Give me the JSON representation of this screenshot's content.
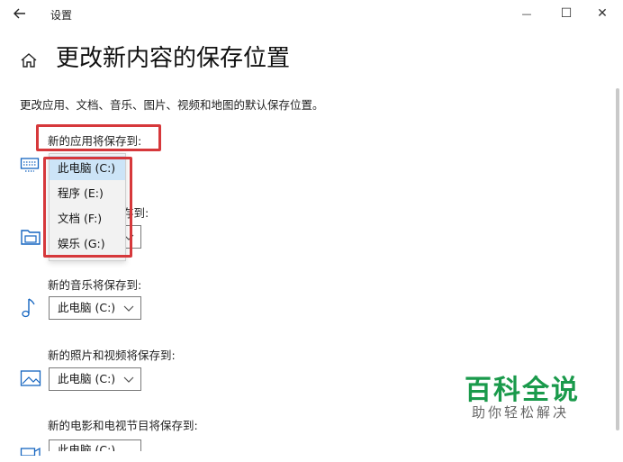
{
  "window": {
    "title": "设置",
    "back_icon": "arrow-left-icon",
    "minimize_glyph": "—",
    "maximize_glyph": "☐",
    "close_glyph": "✕"
  },
  "header": {
    "home_icon": "home-icon",
    "title": "更改新内容的保存位置"
  },
  "description": "更改应用、文档、音乐、图片、视频和地图的默认保存位置。",
  "sections": [
    {
      "label": "新的应用将保存到:",
      "icon": "monitor-icon",
      "value": "此电脑 (C:)"
    },
    {
      "label": "新的文档将保存到:",
      "icon": "folder-icon",
      "value": "此电脑 (C:)"
    },
    {
      "label": "新的音乐将保存到:",
      "icon": "music-note-icon",
      "value": "此电脑 (C:)"
    },
    {
      "label": "新的照片和视频将保存到:",
      "icon": "picture-icon",
      "value": "此电脑 (C:)"
    },
    {
      "label": "新的电影和电视节目将保存到:",
      "icon": "video-icon",
      "value": "此电脑 (C:)"
    }
  ],
  "dropdown_open": {
    "options": [
      "此电脑 (C:)",
      "程序 (E:)",
      "文档 (F:)",
      "娱乐 (G:)"
    ],
    "selected_index": 0
  },
  "documents_partial_label": "存到:",
  "watermark": {
    "main": "百科全说",
    "sub": "助你轻松解决"
  },
  "colors": {
    "highlight": "#d6383b",
    "selected_option": "#cce4f7",
    "watermark": "#1a9a4b"
  }
}
